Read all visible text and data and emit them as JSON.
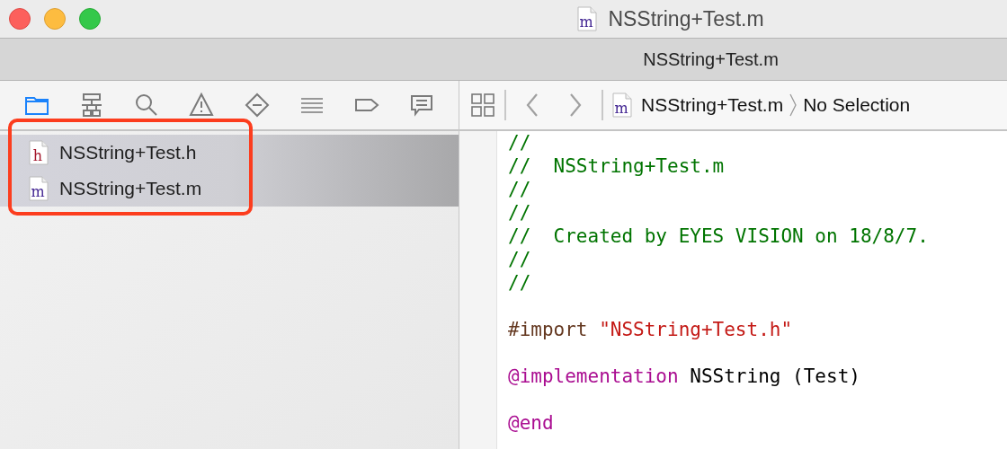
{
  "window": {
    "title": "NSString+Test.m",
    "file_type": "m"
  },
  "tab": {
    "label": "NSString+Test.m"
  },
  "navigator_tabs": [
    {
      "selected": true
    },
    {
      "selected": false
    },
    {
      "selected": false
    },
    {
      "selected": false
    },
    {
      "selected": false
    },
    {
      "selected": false
    },
    {
      "selected": false
    },
    {
      "selected": false
    }
  ],
  "files": [
    {
      "name": "NSString+Test.h",
      "type": "h",
      "selected": true
    },
    {
      "name": "NSString+Test.m",
      "type": "m",
      "selected": true
    }
  ],
  "jump_bar": {
    "file": "NSString+Test.m",
    "file_type": "m",
    "selection": "No Selection"
  },
  "editor": {
    "paragraphs": [
      {
        "lines": [
          {
            "tokens": [
              {
                "kind": "comment",
                "text": "//"
              }
            ]
          },
          {
            "tokens": [
              {
                "kind": "comment",
                "text": "//  NSString+Test.m"
              }
            ]
          },
          {
            "tokens": [
              {
                "kind": "comment",
                "text": "//"
              }
            ]
          },
          {
            "tokens": [
              {
                "kind": "comment",
                "text": "//"
              }
            ]
          },
          {
            "tokens": [
              {
                "kind": "comment",
                "text": "//  Created by EYES VISION on 18/8/7."
              }
            ]
          },
          {
            "tokens": [
              {
                "kind": "comment",
                "text": "//"
              }
            ]
          },
          {
            "tokens": [
              {
                "kind": "comment",
                "text": "//"
              }
            ]
          }
        ]
      },
      {
        "lines": [
          {
            "tokens": [
              {
                "kind": "directive",
                "text": "#import"
              },
              {
                "kind": "string",
                "text": "\"NSString+Test.h\""
              }
            ]
          }
        ]
      },
      {
        "lines": [
          {
            "tokens": [
              {
                "kind": "keyword",
                "text": "@implementation"
              },
              {
                "kind": "plain",
                "text": "NSString (Test)"
              }
            ]
          }
        ]
      },
      {
        "lines": [
          {
            "tokens": [
              {
                "kind": "keyword",
                "text": "@end"
              }
            ]
          }
        ]
      }
    ]
  }
}
